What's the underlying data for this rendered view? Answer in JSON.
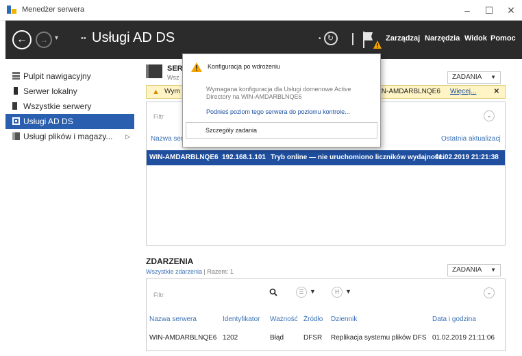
{
  "window": {
    "title": "Menedżer serwera",
    "controls": {
      "minimize": "–",
      "maximize": "☐",
      "close": "✕"
    }
  },
  "header": {
    "back_label": "←",
    "forward_label": "→",
    "history_caret": "▾",
    "crumb_arrows": "••",
    "title": "Usługi AD DS",
    "refresh_dot": "•",
    "refresh_symbol": "↻",
    "menus": {
      "manage": "Zarządzaj",
      "tools": "Narzędzia",
      "view": "Widok",
      "help": "Pomoc"
    }
  },
  "sidebar": {
    "items": [
      {
        "label": "Pulpit nawigacyjny",
        "icon": "dashboard-icon"
      },
      {
        "label": "Serwer lokalny",
        "icon": "server-icon"
      },
      {
        "label": "Wszystkie serwery",
        "icon": "servers-icon"
      },
      {
        "label": "Usługi AD DS",
        "icon": "ad-ds-icon",
        "active": true
      },
      {
        "label": "Usługi plików i magazy...",
        "icon": "file-services-icon",
        "expand": "▷"
      }
    ]
  },
  "servers": {
    "title": "SER",
    "subtitle": "Wsz",
    "tasks_label": "ZADANIA",
    "caret": "▼",
    "warning": {
      "text": "Wym",
      "more": "Więcej...",
      "server": "IN-AMDARBLNQE6",
      "close": "✕"
    },
    "filter_placeholder": "Filtr",
    "filter_chevron": "⌄",
    "columns": {
      "name": "Nazwa ser",
      "last_update": "Ostatnia aktualizacj"
    },
    "selected_row": {
      "name": "WIN-AMDARBLNQE6",
      "ip": "192.168.1.101",
      "status": "Tryb online — nie uruchomiono liczników wydajności",
      "updated": "01.02.2019 21:21:38"
    }
  },
  "popup": {
    "title": "Konfiguracja po wdrożeniu",
    "message": "Wymagana konfiguracja dla Usługi domenowe Active Directory na WIN-AMDARBLNQE6",
    "link": "Podnieś poziom tego serwera do poziomu kontrole...",
    "task_details": "Szczegóły zadania"
  },
  "events": {
    "title": "ZDARZENIA",
    "subtitle_prefix": "Wszystkie zdarzenia",
    "subtitle_total": "Razem: 1",
    "tasks_label": "ZADANIA",
    "caret": "▼",
    "filter_placeholder": "Filtr",
    "filter_chevron": "⌄",
    "list_btn": "☰",
    "h_btn": "H",
    "columns": {
      "server_name": "Nazwa serwera",
      "id": "Identyfikator",
      "severity": "Ważność",
      "source": "Źródło",
      "log": "Dziennik",
      "datetime": "Data i godzina"
    },
    "row": {
      "server_name": "WIN-AMDARBLNQE6",
      "id": "1202",
      "severity": "Błąd",
      "source": "DFSR",
      "log": "Replikacja systemu plików DFS",
      "datetime": "01.02.2019 21:11:06"
    }
  }
}
